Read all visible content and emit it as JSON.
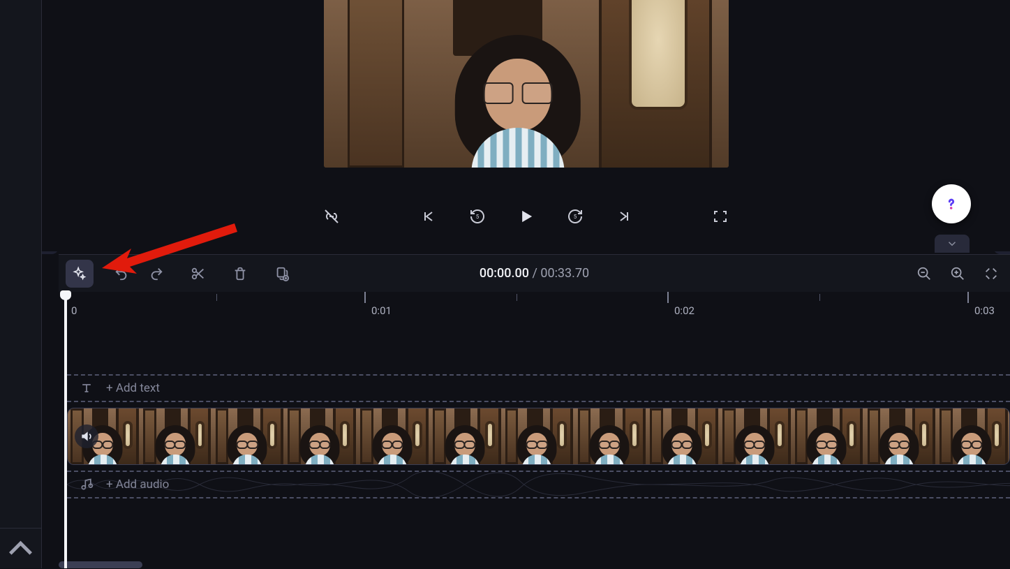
{
  "playback": {
    "current_time": "00:00.00",
    "separator": " / ",
    "total_time": "00:33.70"
  },
  "ruler": {
    "labels": [
      "0",
      "0:01",
      "0:02",
      "0:03"
    ]
  },
  "tracks": {
    "text_hint": "+  Add text",
    "audio_hint": "+  Add audio"
  },
  "icons": {
    "ai_sparkle": "ai-sparkle-icon",
    "undo": "undo-icon",
    "redo": "redo-icon",
    "scissors": "scissors-icon",
    "trash": "trash-icon",
    "copy_plus": "copy-plus-icon",
    "zoom_out": "zoom-out-icon",
    "zoom_in": "zoom-in-icon",
    "zoom_fit": "zoom-fit-icon",
    "link_off": "link-off-icon",
    "skip_start": "skip-start-icon",
    "back5": "rewind-5-icon",
    "play": "play-icon",
    "fwd5": "forward-5-icon",
    "skip_end": "skip-end-icon",
    "fullscreen": "fullscreen-icon",
    "help": "help-icon",
    "chevron_down": "chevron-down-icon",
    "chevron_left": "chevron-left-icon",
    "chevron_up": "chevron-up-icon",
    "volume": "volume-icon",
    "text_t": "text-t-icon",
    "music": "music-note-icon"
  },
  "annotation": {
    "type": "red-arrow",
    "points_to": "ai-sparkle-button"
  }
}
